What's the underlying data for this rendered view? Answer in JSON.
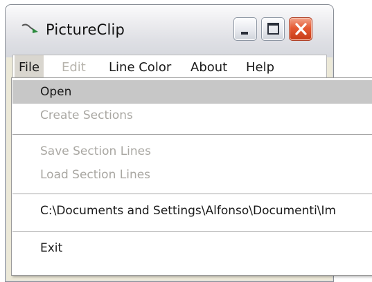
{
  "window": {
    "title": "PictureClip",
    "app_icon": "pictureclip-app-icon",
    "controls": {
      "minimize_icon": "minimize-icon",
      "maximize_icon": "maximize-icon",
      "close_icon": "close-icon"
    }
  },
  "menubar": {
    "items": [
      {
        "label": "File",
        "enabled": true,
        "open": true
      },
      {
        "label": "Edit",
        "enabled": false
      },
      {
        "label": "Line Color",
        "enabled": true
      },
      {
        "label": "About",
        "enabled": true
      },
      {
        "label": "Help",
        "enabled": true
      }
    ]
  },
  "file_menu": {
    "open": "Open",
    "create_sections": "Create Sections",
    "save_section_lines": "Save Section Lines",
    "load_section_lines": "Load Section Lines",
    "recent_file": "C:\\Documents and Settings\\Alfonso\\Documenti\\Im",
    "exit": "Exit"
  },
  "colors": {
    "highlight": "#c7c7c7",
    "disabled_text": "#a9a7a2",
    "close_button": "#e55a33"
  }
}
